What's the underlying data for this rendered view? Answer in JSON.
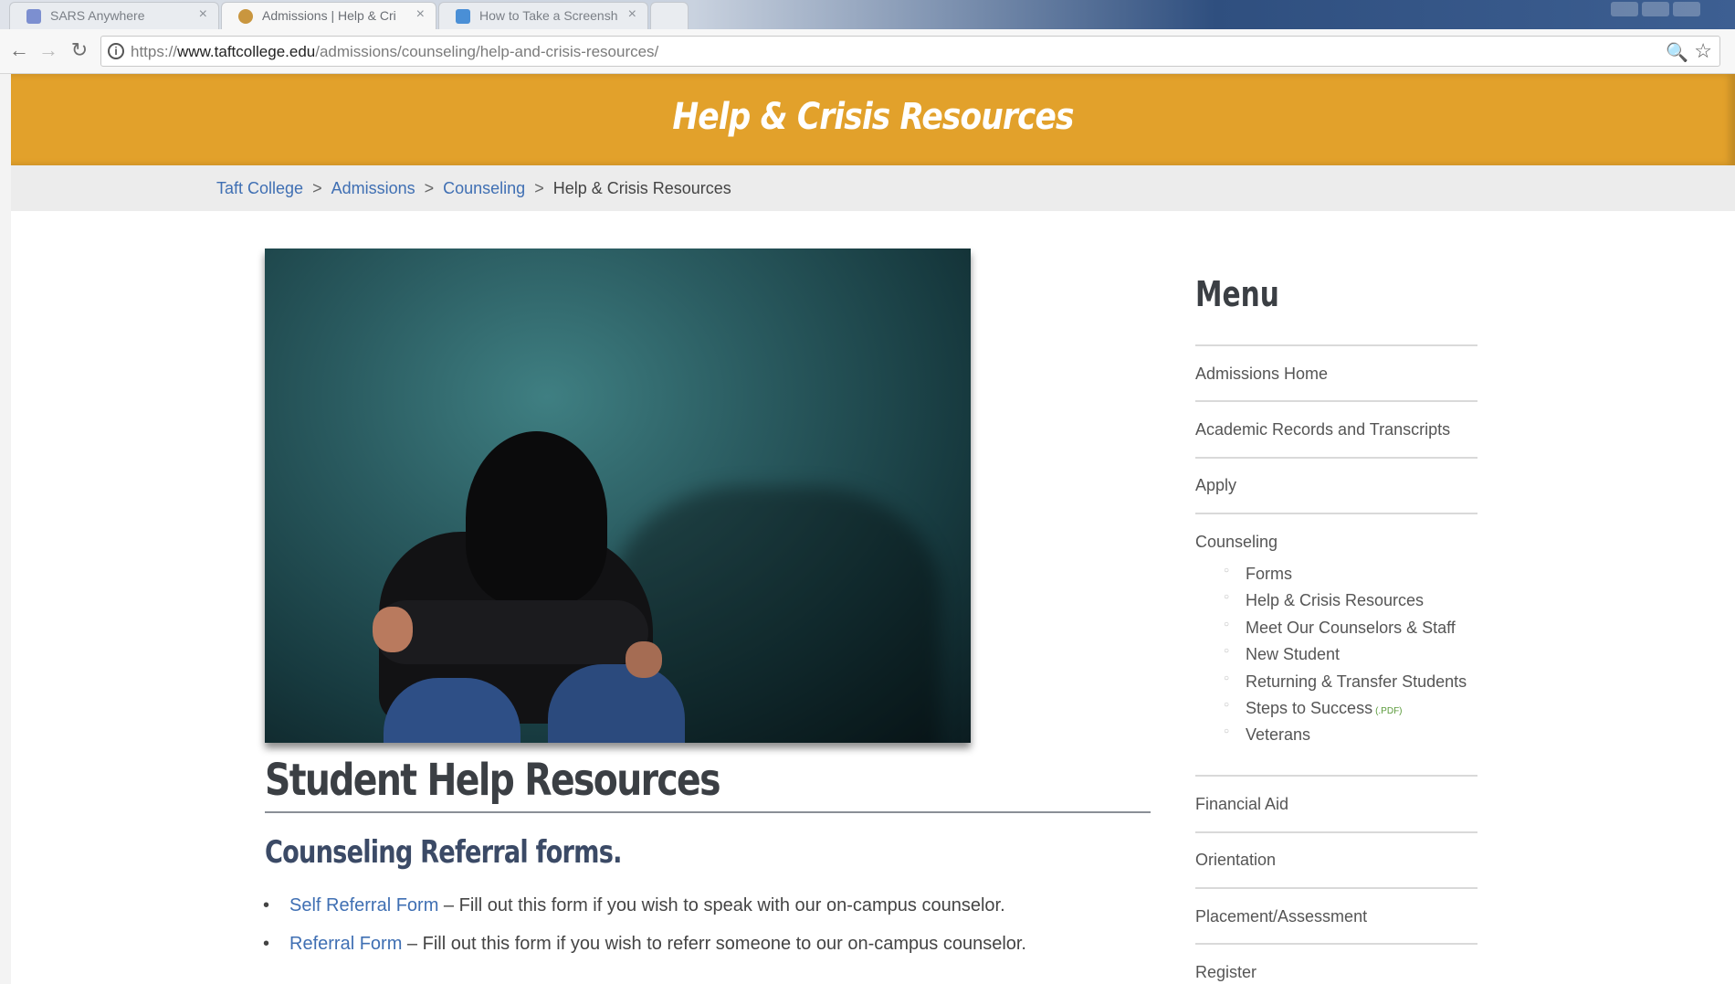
{
  "browser": {
    "tabs": [
      {
        "label": "SARS Anywhere",
        "close": "×"
      },
      {
        "label": "Admissions | Help & Cri",
        "close": "×"
      },
      {
        "label": "How to Take a Screensh",
        "close": "×"
      }
    ],
    "url_scheme": "https://",
    "url_host": "www.taftcollege.edu",
    "url_path": "/admissions/counseling/help-and-crisis-resources/",
    "icons": {
      "back": "←",
      "forward": "→",
      "reload": "↻",
      "info": "i",
      "zoom": "🔍",
      "star": "☆"
    }
  },
  "banner": {
    "title": "Help & Crisis Resources",
    "color": "#e2a12b"
  },
  "breadcrumb": {
    "items": [
      "Taft College",
      "Admissions",
      "Counseling"
    ],
    "current": "Help & Crisis Resources",
    "separator": ">"
  },
  "main": {
    "heading": "Student Help Resources",
    "subheading": "Counseling Referral forms.",
    "links": [
      {
        "link_text": "Self Referral Form",
        "description": " – Fill out this form if you wish to speak with our on-campus counselor."
      },
      {
        "link_text": "Referral Form",
        "description": " – Fill out this form if you wish to referr someone to our on-campus counselor."
      }
    ]
  },
  "sidebar": {
    "title": "Menu",
    "items": [
      "Admissions Home",
      "Academic Records and Transcripts",
      "Apply",
      "Counseling",
      "Financial Aid",
      "Orientation",
      "Placement/Assessment",
      "Register"
    ],
    "counseling_sub": [
      "Forms",
      "Help & Crisis Resources",
      "Meet Our Counselors & Staff",
      "New Student",
      "Returning & Transfer Students",
      "Steps to Success",
      "Veterans"
    ],
    "pdf_tag": "(.PDF)"
  },
  "colors": {
    "link": "#3f6fb3",
    "accent": "#e2a12b"
  }
}
